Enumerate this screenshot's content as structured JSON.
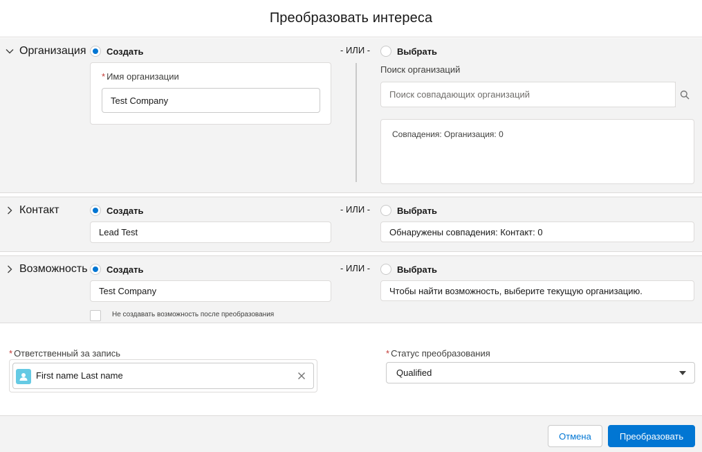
{
  "modal": {
    "title": "Преобразовать интереса"
  },
  "account": {
    "section_title": "Организация",
    "create_label": "Создать",
    "or_label": "- ИЛИ -",
    "choose_label": "Выбрать",
    "name_required_mark": "*",
    "name_label": "Имя организации",
    "name_value": "Test Company",
    "search_label": "Поиск организаций",
    "search_placeholder": "Поиск совпадающих организаций",
    "matches_text": "Совпадения: Организация: 0"
  },
  "contact": {
    "section_title": "Контакт",
    "create_label": "Создать",
    "or_label": "- ИЛИ -",
    "choose_label": "Выбрать",
    "name_value": "Lead Test",
    "matches_text": "Обнаружены совпадения: Контакт: 0"
  },
  "opportunity": {
    "section_title": "Возможность",
    "create_label": "Создать",
    "or_label": "- ИЛИ -",
    "choose_label": "Выбрать",
    "name_value": "Test Company",
    "info_text": "Чтобы найти возможность, выберите текущую организацию.",
    "dont_create_label": "Не создавать возможность после преобразования"
  },
  "owner": {
    "required_mark": "*",
    "label": "Ответственный за запись",
    "value": "First name Last name"
  },
  "status": {
    "required_mark": "*",
    "label": "Статус преобразования",
    "value": "Qualified"
  },
  "footer": {
    "cancel_label": "Отмена",
    "convert_label": "Преобразовать"
  },
  "colors": {
    "brand": "#0176d3",
    "section_bg": "#f3f3f3",
    "required": "#c23934",
    "avatar": "#65cae4"
  }
}
